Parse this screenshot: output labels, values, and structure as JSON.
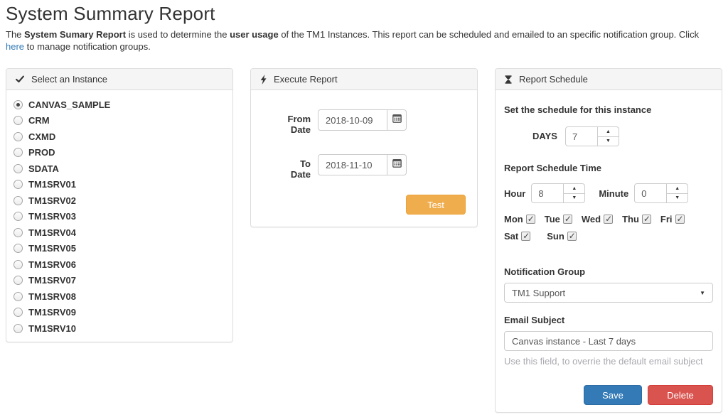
{
  "page": {
    "title": "System Summary Report",
    "description": {
      "part1": "The ",
      "bold1": "System Sumary Report",
      "part2": " is used to determine the ",
      "bold2": "user usage",
      "part3": " of the TM1 Instances. This report can be scheduled and emailed to an specific notification group. Click ",
      "link": "here",
      "part4": " to manage notification groups."
    }
  },
  "panels": {
    "instance": {
      "header": "Select an Instance",
      "icon": "check-icon",
      "items": [
        {
          "label": "CANVAS_SAMPLE",
          "selected": true
        },
        {
          "label": "CRM",
          "selected": false
        },
        {
          "label": "CXMD",
          "selected": false
        },
        {
          "label": "PROD",
          "selected": false
        },
        {
          "label": "SDATA",
          "selected": false
        },
        {
          "label": "TM1SRV01",
          "selected": false
        },
        {
          "label": "TM1SRV02",
          "selected": false
        },
        {
          "label": "TM1SRV03",
          "selected": false
        },
        {
          "label": "TM1SRV04",
          "selected": false
        },
        {
          "label": "TM1SRV05",
          "selected": false
        },
        {
          "label": "TM1SRV06",
          "selected": false
        },
        {
          "label": "TM1SRV07",
          "selected": false
        },
        {
          "label": "TM1SRV08",
          "selected": false
        },
        {
          "label": "TM1SRV09",
          "selected": false
        },
        {
          "label": "TM1SRV10",
          "selected": false
        }
      ]
    },
    "execute": {
      "header": "Execute Report",
      "icon": "bolt-icon",
      "from": {
        "label": "From Date",
        "value": "2018-10-09"
      },
      "to": {
        "label": "To Date",
        "value": "2018-11-10"
      },
      "test_label": "Test"
    },
    "schedule": {
      "header": "Report Schedule",
      "icon": "hourglass-icon",
      "subtitle": "Set the schedule for this instance",
      "days": {
        "label": "DAYS",
        "value": "7"
      },
      "time_title": "Report Schedule Time",
      "hour": {
        "label": "Hour",
        "value": "8"
      },
      "minute": {
        "label": "Minute",
        "value": "0"
      },
      "weekdays": [
        {
          "label": "Mon",
          "checked": true
        },
        {
          "label": "Tue",
          "checked": true
        },
        {
          "label": "Wed",
          "checked": true
        },
        {
          "label": "Thu",
          "checked": true
        },
        {
          "label": "Fri",
          "checked": true
        },
        {
          "label": "Sat",
          "checked": true
        },
        {
          "label": "Sun",
          "checked": true
        }
      ],
      "notification": {
        "label": "Notification Group",
        "value": "TM1 Support"
      },
      "email": {
        "label": "Email Subject",
        "value": "Canvas instance - Last 7 days",
        "help": "Use this field, to overrie the default email subject"
      },
      "save_label": "Save",
      "delete_label": "Delete"
    }
  },
  "colors": {
    "link_blue": "#337ab7",
    "test_orange": "#f0ad4e",
    "save_blue": "#337ab7",
    "delete_red": "#d9534f",
    "panel_border": "#dddddd",
    "panel_heading_bg": "#f5f5f5"
  }
}
